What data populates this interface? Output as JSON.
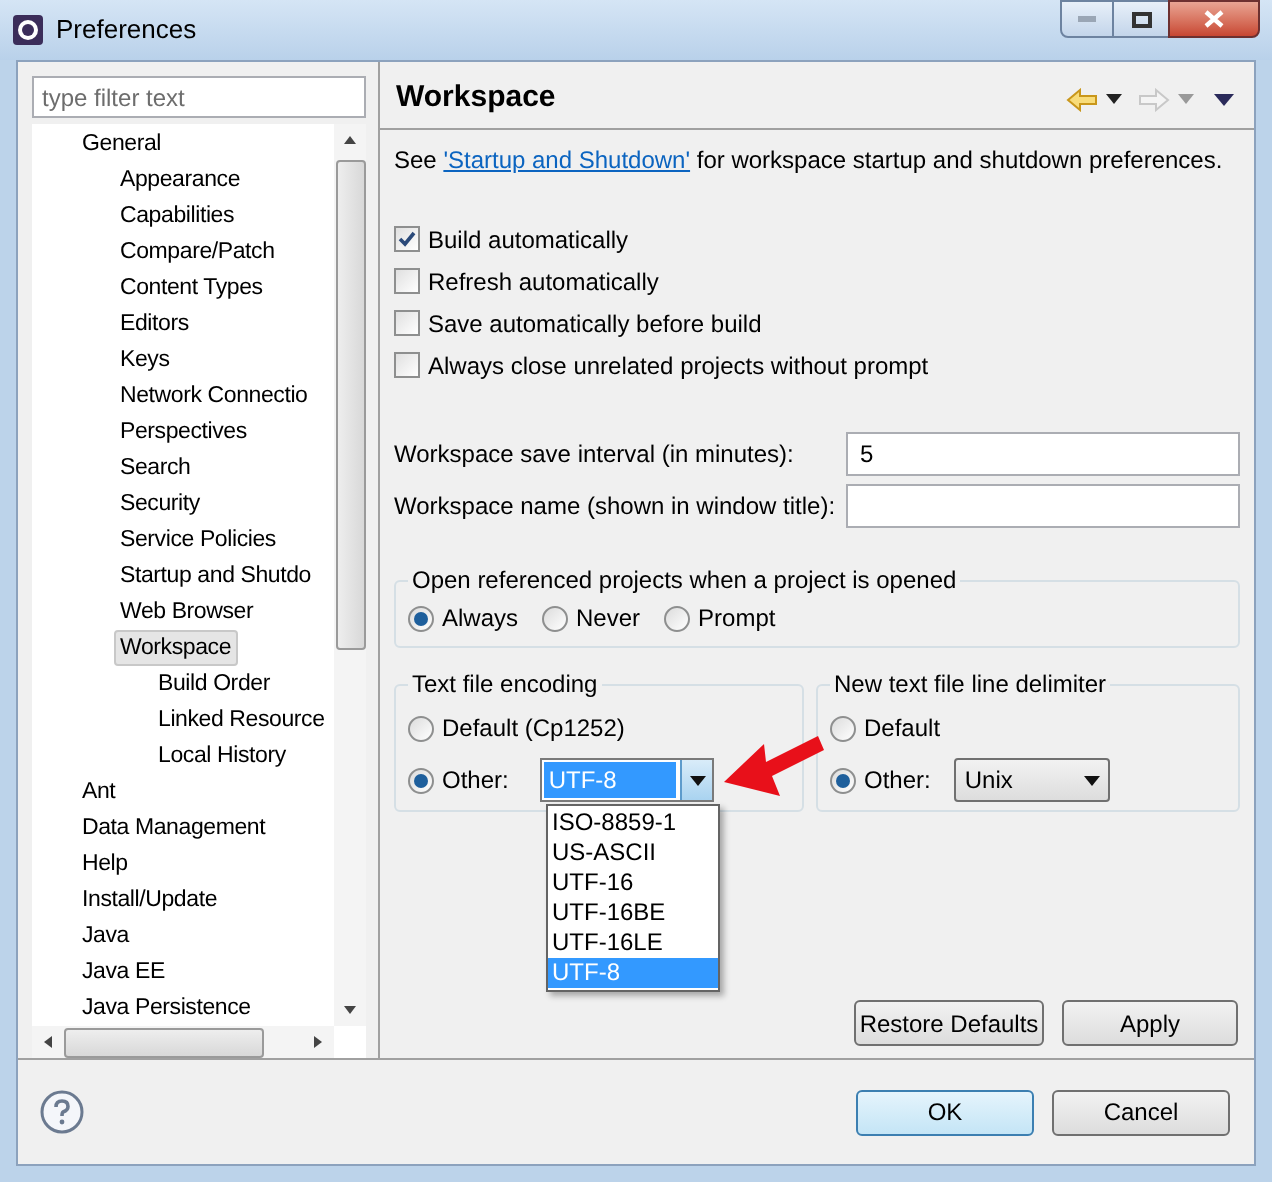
{
  "window": {
    "title": "Preferences"
  },
  "filter": {
    "placeholder": "type filter text"
  },
  "tree": [
    {
      "label": "General",
      "selected": false,
      "children": [
        {
          "label": "Appearance",
          "selected": false
        },
        {
          "label": "Capabilities",
          "selected": false
        },
        {
          "label": "Compare/Patch",
          "selected": false
        },
        {
          "label": "Content Types",
          "selected": false
        },
        {
          "label": "Editors",
          "selected": false
        },
        {
          "label": "Keys",
          "selected": false
        },
        {
          "label": "Network Connectio",
          "selected": false
        },
        {
          "label": "Perspectives",
          "selected": false
        },
        {
          "label": "Search",
          "selected": false
        },
        {
          "label": "Security",
          "selected": false
        },
        {
          "label": "Service Policies",
          "selected": false
        },
        {
          "label": "Startup and Shutdo",
          "selected": false
        },
        {
          "label": "Web Browser",
          "selected": false
        },
        {
          "label": "Workspace",
          "selected": true,
          "children": [
            {
              "label": "Build Order",
              "selected": false
            },
            {
              "label": "Linked Resource",
              "selected": false
            },
            {
              "label": "Local History",
              "selected": false
            }
          ]
        }
      ]
    },
    {
      "label": "Ant",
      "selected": false
    },
    {
      "label": "Data Management",
      "selected": false
    },
    {
      "label": "Help",
      "selected": false
    },
    {
      "label": "Install/Update",
      "selected": false
    },
    {
      "label": "Java",
      "selected": false
    },
    {
      "label": "Java EE",
      "selected": false
    },
    {
      "label": "Java Persistence",
      "selected": false
    }
  ],
  "page": {
    "title": "Workspace",
    "intro": {
      "before": "See ",
      "link": "'Startup and Shutdown'",
      "after": " for workspace startup and shutdown preferences."
    },
    "checkboxes": [
      {
        "label": "Build automatically",
        "checked": true
      },
      {
        "label": "Refresh automatically",
        "checked": false
      },
      {
        "label": "Save automatically before build",
        "checked": false
      },
      {
        "label": "Always close unrelated projects without prompt",
        "checked": false
      }
    ],
    "fields": [
      {
        "label": "Workspace save interval (in minutes):",
        "value": "5"
      },
      {
        "label": "Workspace name (shown in window title):"
      }
    ],
    "open_projects": {
      "title": "Open referenced projects when a project is opened",
      "options": [
        {
          "label": "Always",
          "selected": true
        },
        {
          "label": "Never",
          "selected": false
        },
        {
          "label": "Prompt",
          "selected": false
        }
      ]
    },
    "encoding": {
      "title": "Text file encoding",
      "options": [
        {
          "label": "Default (Cp1252)",
          "selected": false
        },
        {
          "label": "Other:",
          "selected": true
        }
      ],
      "combo_value": "UTF-8",
      "dropdown": [
        {
          "label": "ISO-8859-1",
          "selected": false
        },
        {
          "label": "US-ASCII",
          "selected": false
        },
        {
          "label": "UTF-16",
          "selected": false
        },
        {
          "label": "UTF-16BE",
          "selected": false
        },
        {
          "label": "UTF-16LE",
          "selected": false
        },
        {
          "label": "UTF-8",
          "selected": true
        }
      ]
    },
    "delimiter": {
      "title": "New text file line delimiter",
      "options": [
        {
          "label": "Default",
          "selected": false
        },
        {
          "label": "Other:",
          "selected": true
        }
      ],
      "combo_value": "Unix"
    },
    "buttons": [
      "Restore Defaults",
      "Apply"
    ]
  },
  "footer": {
    "buttons": [
      {
        "label": "OK",
        "kind": "default"
      },
      {
        "label": "Cancel",
        "kind": "normal"
      }
    ]
  }
}
